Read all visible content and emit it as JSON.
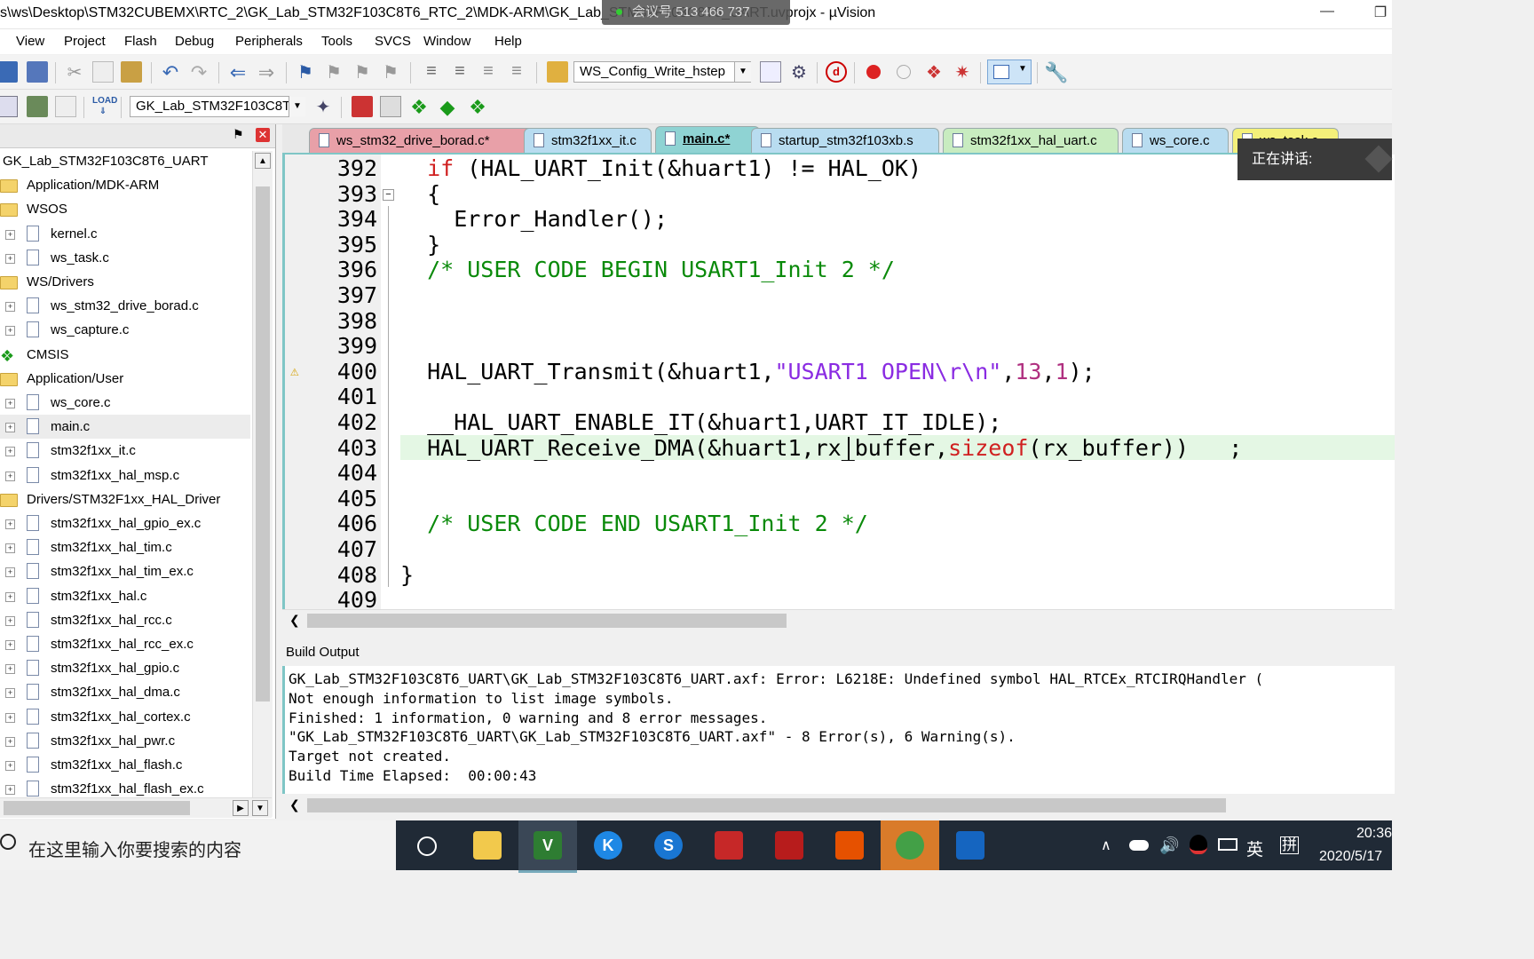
{
  "window": {
    "title": "s\\ws\\Desktop\\STM32CUBEMX\\RTC_2\\GK_Lab_STM32F103C8T6_RTC_2\\MDK-ARM\\GK_Lab_STM32F103C8T6_UART.uvprojx - µVision",
    "meeting_overlay": "会议号 513 466 737"
  },
  "menu": [
    "View",
    "Project",
    "Flash",
    "Debug",
    "Peripherals",
    "Tools",
    "SVCS",
    "Window",
    "Help"
  ],
  "toolbar": {
    "config_combo": "WS_Config_Write_hstep",
    "target_combo": "GK_Lab_STM32F103C8T6"
  },
  "project": {
    "items": [
      {
        "label": "GK_Lab_STM32F103C8T6_UART",
        "type": "root"
      },
      {
        "label": "Application/MDK-ARM",
        "type": "folder"
      },
      {
        "label": "WSOS",
        "type": "folder"
      },
      {
        "label": "kernel.c",
        "type": "file"
      },
      {
        "label": "ws_task.c",
        "type": "file"
      },
      {
        "label": "WS/Drivers",
        "type": "folder"
      },
      {
        "label": "ws_stm32_drive_borad.c",
        "type": "file"
      },
      {
        "label": "ws_capture.c",
        "type": "file"
      },
      {
        "label": "CMSIS",
        "type": "cmsis"
      },
      {
        "label": "Application/User",
        "type": "folder"
      },
      {
        "label": "ws_core.c",
        "type": "file"
      },
      {
        "label": "main.c",
        "type": "file",
        "selected": true
      },
      {
        "label": "stm32f1xx_it.c",
        "type": "file"
      },
      {
        "label": "stm32f1xx_hal_msp.c",
        "type": "file"
      },
      {
        "label": "Drivers/STM32F1xx_HAL_Driver",
        "type": "folder"
      },
      {
        "label": "stm32f1xx_hal_gpio_ex.c",
        "type": "file"
      },
      {
        "label": "stm32f1xx_hal_tim.c",
        "type": "file"
      },
      {
        "label": "stm32f1xx_hal_tim_ex.c",
        "type": "file"
      },
      {
        "label": "stm32f1xx_hal.c",
        "type": "file"
      },
      {
        "label": "stm32f1xx_hal_rcc.c",
        "type": "file"
      },
      {
        "label": "stm32f1xx_hal_rcc_ex.c",
        "type": "file"
      },
      {
        "label": "stm32f1xx_hal_gpio.c",
        "type": "file"
      },
      {
        "label": "stm32f1xx_hal_dma.c",
        "type": "file"
      },
      {
        "label": "stm32f1xx_hal_cortex.c",
        "type": "file"
      },
      {
        "label": "stm32f1xx_hal_pwr.c",
        "type": "file"
      },
      {
        "label": "stm32f1xx_hal_flash.c",
        "type": "file"
      },
      {
        "label": "stm32f1xx_hal_flash_ex.c",
        "type": "file"
      }
    ]
  },
  "tabs": [
    {
      "label": "ws_stm32_drive_borad.c*",
      "color": "#e8a0a8"
    },
    {
      "label": "stm32f1xx_it.c",
      "color": "#b8dcf0"
    },
    {
      "label": "main.c*",
      "color": "#8fd3d3",
      "active": true
    },
    {
      "label": "startup_stm32f103xb.s",
      "color": "#b8dcf0"
    },
    {
      "label": "stm32f1xx_hal_uart.c",
      "color": "#c8ecc0"
    },
    {
      "label": "ws_core.c",
      "color": "#b8dcf0"
    },
    {
      "label": "ws_task.c",
      "color": "#f4f07a"
    }
  ],
  "editor": {
    "lines": [
      {
        "n": "392",
        "code": "  if (HAL_UART_Init(&huart1) != HAL_OK)"
      },
      {
        "n": "393",
        "code": "  {"
      },
      {
        "n": "394",
        "code": "    Error_Handler();"
      },
      {
        "n": "395",
        "code": "  }"
      },
      {
        "n": "396",
        "code": "  /* USER CODE BEGIN USART1_Init 2 */"
      },
      {
        "n": "397",
        "code": ""
      },
      {
        "n": "398",
        "code": ""
      },
      {
        "n": "399",
        "code": ""
      },
      {
        "n": "400",
        "code": "  HAL_UART_Transmit(&huart1,\"USART1 OPEN\\r\\n\",13,1);",
        "warning": true
      },
      {
        "n": "401",
        "code": ""
      },
      {
        "n": "402",
        "code": "  __HAL_UART_ENABLE_IT(&huart1,UART_IT_IDLE);"
      },
      {
        "n": "403",
        "code": "  HAL_UART_Receive_DMA(&huart1,rx_buffer,sizeof(rx_buffer))   ;",
        "current": true
      },
      {
        "n": "404",
        "code": ""
      },
      {
        "n": "405",
        "code": ""
      },
      {
        "n": "406",
        "code": "  /* USER CODE END USART1_Init 2 */"
      },
      {
        "n": "407",
        "code": ""
      },
      {
        "n": "408",
        "code": "}"
      },
      {
        "n": "409",
        "code": ""
      }
    ]
  },
  "build": {
    "title": "Build Output",
    "lines": [
      "GK_Lab_STM32F103C8T6_UART\\GK_Lab_STM32F103C8T6_UART.axf: Error: L6218E: Undefined symbol HAL_RTCEx_RTCIRQHandler (",
      "Not enough information to list image symbols.",
      "Finished: 1 information, 0 warning and 8 error messages.",
      "\"GK_Lab_STM32F103C8T6_UART\\GK_Lab_STM32F103C8T6_UART.axf\" - 8 Error(s), 6 Warning(s).",
      "Target not created.",
      "Build Time Elapsed:  00:00:43"
    ]
  },
  "speaking": "正在讲话:",
  "taskbar": {
    "search_placeholder": "在这里输入你要搜索的内容",
    "time": "20:36",
    "date": "2020/5/17",
    "ime1": "英",
    "ime2": "拼"
  }
}
